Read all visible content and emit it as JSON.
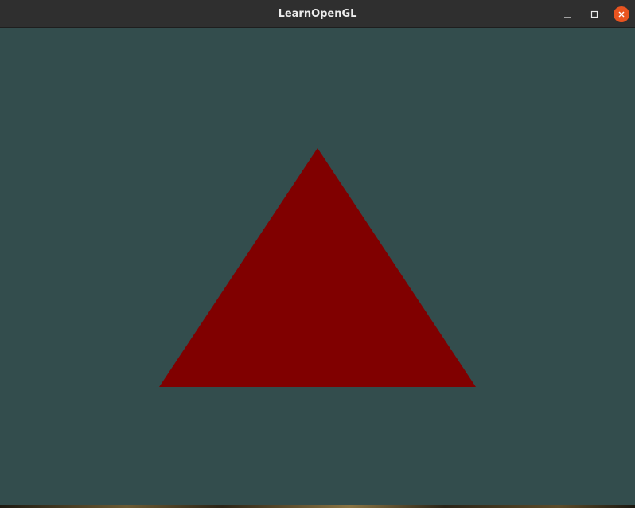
{
  "window": {
    "title": "LearnOpenGL"
  },
  "buttons": {
    "minimize_icon": "minimize-icon",
    "maximize_icon": "maximize-icon",
    "close_icon": "close-icon"
  },
  "scene": {
    "clear_color": "#334d4d",
    "triangle_color": "#800000"
  },
  "colors": {
    "close_button": "#e95420",
    "titlebar": "#2f2f2f"
  }
}
